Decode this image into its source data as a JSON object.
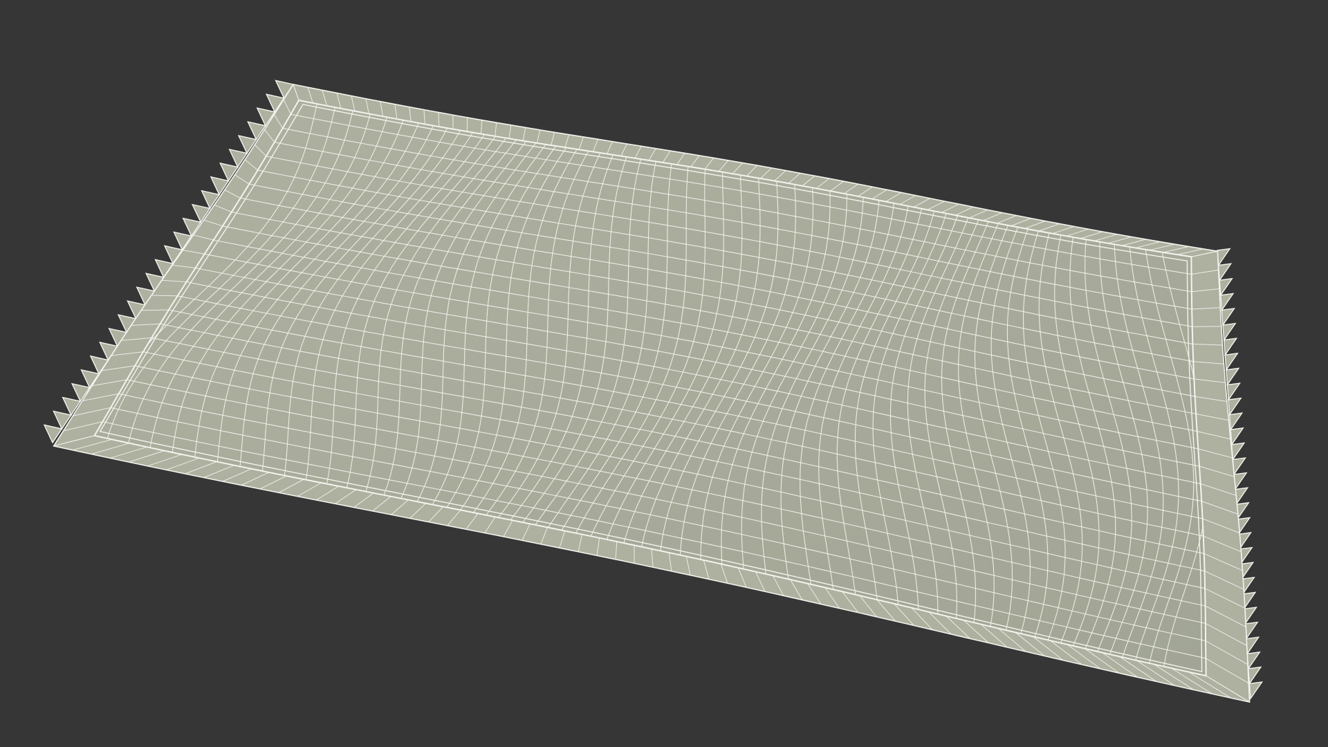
{
  "scene": {
    "subject": "pillow-wireframe-render",
    "colors": {
      "background": "#363636",
      "surface": "#aeb0a0",
      "surface_shade": "#a2a595",
      "wire": "#f4f4ee"
    }
  }
}
